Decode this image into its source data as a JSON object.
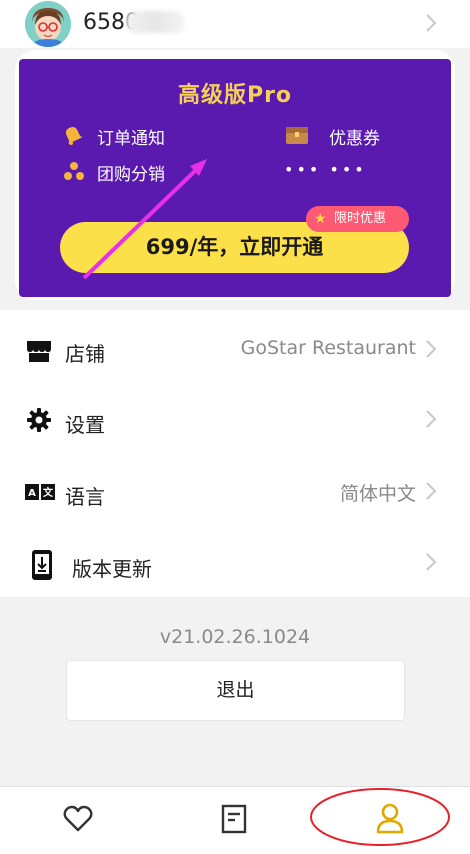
{
  "header": {
    "user_id": "6580"
  },
  "pro_card": {
    "title": "高级版Pro",
    "features": [
      "订单通知",
      "优惠券",
      "团购分销",
      "••• •••"
    ],
    "cta_label": "699/年，立即开通",
    "badge": "限时优惠",
    "colors": {
      "background": "#5a1ab0",
      "cta": "#fbe04a",
      "badge": "#ff5a73",
      "title": "#f5cf58"
    }
  },
  "menu": {
    "items": [
      {
        "label": "店铺",
        "value": "GoStar Restaurant",
        "icon": "shop-icon"
      },
      {
        "label": "设置",
        "value": "",
        "icon": "gear-icon"
      },
      {
        "label": "语言",
        "value": "简体中文",
        "icon": "translate-icon"
      },
      {
        "label": "版本更新",
        "value": "",
        "icon": "phone-download-icon"
      }
    ]
  },
  "version": "v21.02.26.1024",
  "logout_label": "退出",
  "bottom_nav": [
    "heart-icon",
    "orders-icon",
    "profile-icon"
  ]
}
